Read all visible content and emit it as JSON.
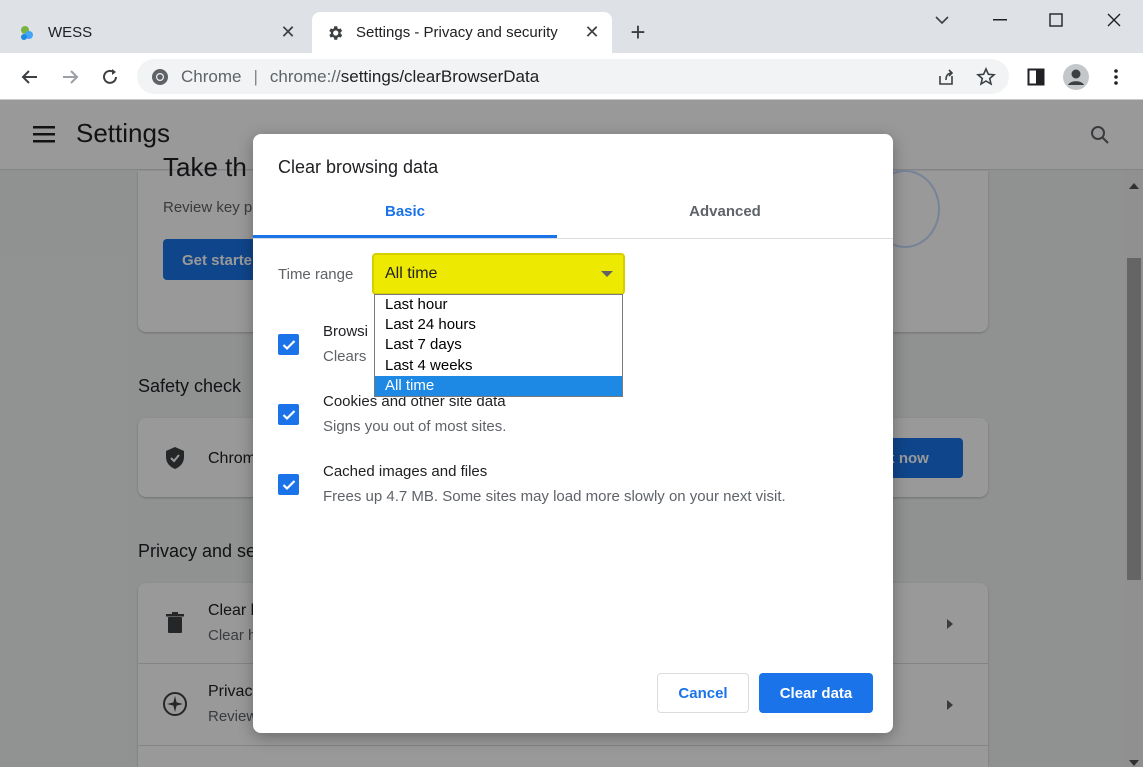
{
  "tabs": [
    {
      "title": "WESS"
    },
    {
      "title": "Settings - Privacy and security"
    }
  ],
  "omnibox": {
    "site": "Chrome",
    "separator": "|",
    "scheme": "chrome://",
    "path": "settings/clearBrowserData"
  },
  "settings": {
    "title": "Settings",
    "card_heading": "Take th",
    "card_sub": "Review key p",
    "get_started": "Get starte",
    "safety_check_title": "Safety check",
    "safety_item": "Chrom",
    "check_now": "ck now",
    "privacy_title": "Privacy and se",
    "clear_item_title": "Clear b",
    "clear_item_sub": "Clear h",
    "privacy_item_title": "Privac",
    "privacy_item_sub": "Review"
  },
  "dialog": {
    "title": "Clear browsing data",
    "tabs": {
      "basic": "Basic",
      "advanced": "Advanced"
    },
    "time_range_label": "Time range",
    "time_range_value": "All time",
    "time_range_options": [
      "Last hour",
      "Last 24 hours",
      "Last 7 days",
      "Last 4 weeks",
      "All time"
    ],
    "options": [
      {
        "title": "Browsi",
        "sub": "Clears",
        "checked": true
      },
      {
        "title": "Cookies and other site data",
        "sub": "Signs you out of most sites.",
        "checked": true
      },
      {
        "title": "Cached images and files",
        "sub": "Frees up 4.7 MB. Some sites may load more slowly on your next visit.",
        "checked": true
      }
    ],
    "cancel": "Cancel",
    "clear": "Clear data"
  },
  "colors": {
    "accent": "#1a73e8",
    "highlight": "#eee900",
    "selected": "#1e88e5"
  }
}
